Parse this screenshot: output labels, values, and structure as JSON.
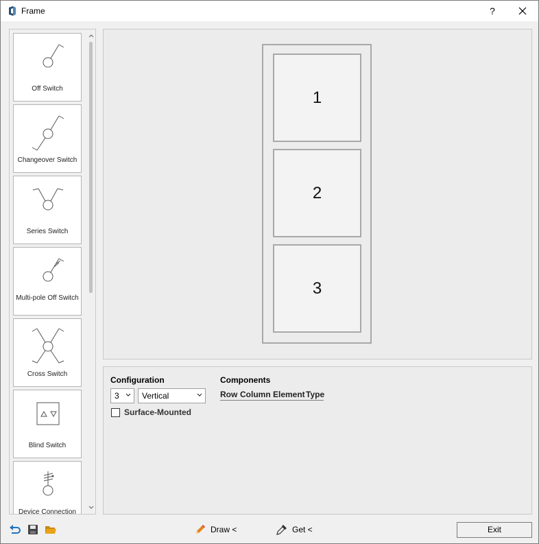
{
  "window": {
    "title": "Frame",
    "help_label": "?"
  },
  "palette": {
    "items": [
      {
        "label": "Off Switch",
        "icon": "off-switch-icon"
      },
      {
        "label": "Changeover Switch",
        "icon": "changeover-switch-icon"
      },
      {
        "label": "Series Switch",
        "icon": "series-switch-icon"
      },
      {
        "label": "Multi-pole Off Switch",
        "icon": "multi-pole-off-switch-icon"
      },
      {
        "label": "Cross Switch",
        "icon": "cross-switch-icon"
      },
      {
        "label": "Blind Switch",
        "icon": "blind-switch-icon"
      },
      {
        "label": "Device Connection",
        "icon": "device-connection-icon"
      }
    ]
  },
  "preview": {
    "cells": [
      "1",
      "2",
      "3"
    ]
  },
  "configuration": {
    "heading": "Configuration",
    "count_value": "3",
    "orientation_value": "Vertical",
    "surface_mounted_label": "Surface-Mounted",
    "surface_mounted_checked": false
  },
  "components": {
    "heading": "Components",
    "columns": [
      "Row",
      "Column",
      "Element",
      "Type"
    ]
  },
  "bottom": {
    "draw_label": "Draw <",
    "get_label": "Get <",
    "exit_label": "Exit"
  },
  "colors": {
    "accent_blue": "#1e73be",
    "folder_orange": "#e8a317",
    "pencil_orange": "#e8821e"
  }
}
